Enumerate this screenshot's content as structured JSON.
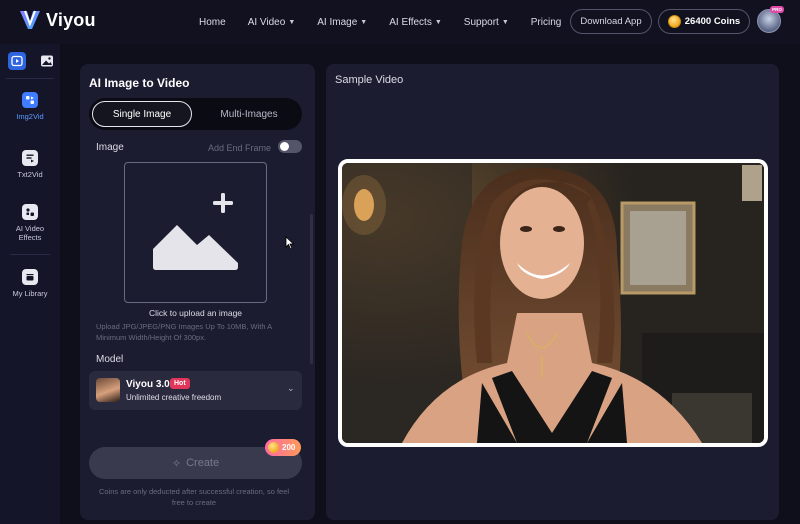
{
  "header": {
    "brand": "Viyou",
    "nav": [
      {
        "label": "Home",
        "dropdown": false
      },
      {
        "label": "AI Video",
        "dropdown": true
      },
      {
        "label": "AI Image",
        "dropdown": true
      },
      {
        "label": "AI Effects",
        "dropdown": true
      },
      {
        "label": "Support",
        "dropdown": true
      },
      {
        "label": "Pricing",
        "dropdown": false
      }
    ],
    "download_label": "Download App",
    "coins_label": "26400 Coins",
    "vip_label": "PRO"
  },
  "sidebar": {
    "items": [
      {
        "label": "Img2Vid",
        "active": true
      },
      {
        "label": "Txt2Vid",
        "active": false
      },
      {
        "label": "AI Video Effects",
        "active": false
      },
      {
        "label": "My Library",
        "active": false
      }
    ]
  },
  "panel": {
    "title": "AI Image to Video",
    "tabs": [
      "Single Image",
      "Multi-Images"
    ],
    "image_label": "Image",
    "end_frame_label": "Add End Frame",
    "end_frame_enabled": false,
    "upload_caption": "Click to upload an image",
    "upload_hint": "Upload JPG/JPEG/PNG Images Up To 10MB, With A Minimum Width/Height Of 300px.",
    "model_label": "Model",
    "model": {
      "name": "Viyou 3.0",
      "badge": "Hot",
      "description": "Unlimited creative freedom"
    },
    "create_label": "Create",
    "cost": "200",
    "coin_note": "Coins are only deducted after successful creation, so feel free to create"
  },
  "preview": {
    "title": "Sample Video"
  },
  "colors": {
    "accent": "#3f7cff",
    "background": "#0f0f1c",
    "panel": "#1c1c30",
    "hot": "#e0365a"
  }
}
